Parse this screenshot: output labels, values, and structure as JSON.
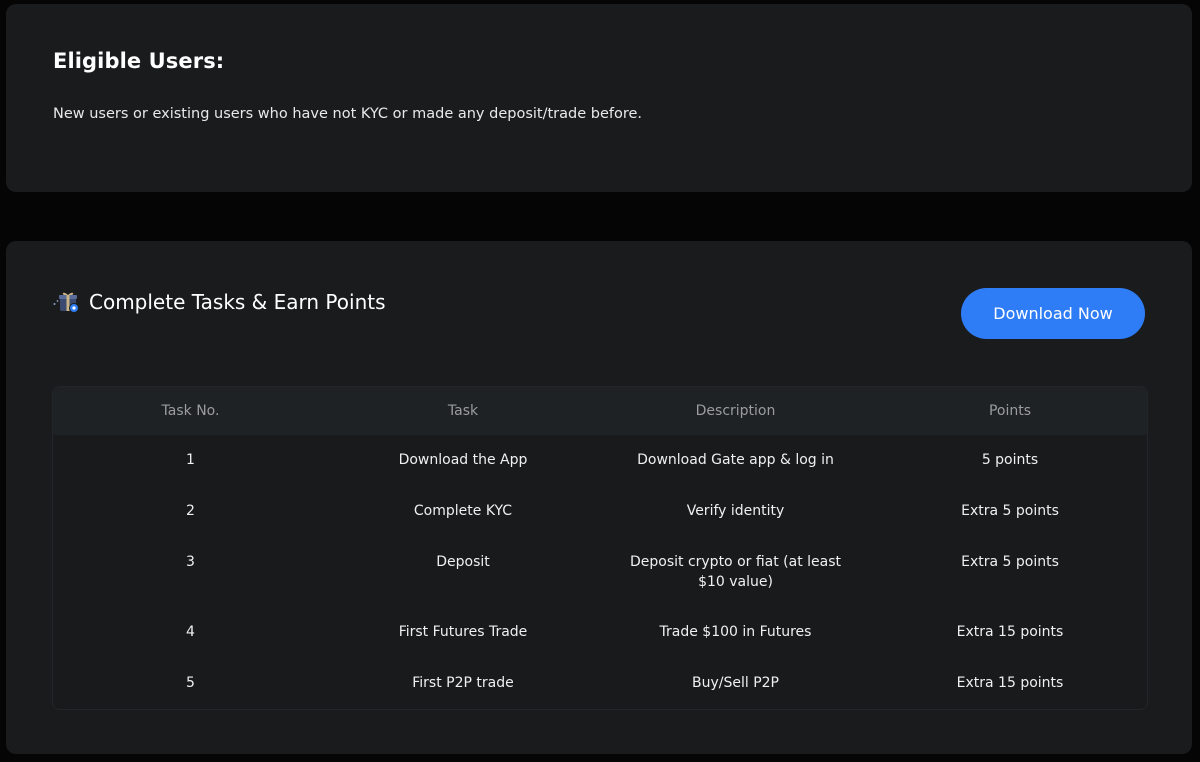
{
  "eligible": {
    "title": "Eligible Users:",
    "text": "New users or existing users who have not KYC or made any deposit/trade before."
  },
  "tasks": {
    "title": "Complete Tasks & Earn Points",
    "icon": "gift-icon",
    "download_button": "Download Now",
    "accent_color": "#2e7df6",
    "table": {
      "headers": [
        "Task No.",
        "Task",
        "Description",
        "Points"
      ],
      "rows": [
        {
          "no": "1",
          "task": "Download the App",
          "description": "Download Gate app & log in",
          "points": "5 points"
        },
        {
          "no": "2",
          "task": "Complete KYC",
          "description": "Verify identity",
          "points": "Extra 5 points"
        },
        {
          "no": "3",
          "task": "Deposit",
          "description": "Deposit crypto or fiat (at least $10 value)",
          "points": "Extra 5 points"
        },
        {
          "no": "4",
          "task": "First Futures Trade",
          "description": "Trade $100 in Futures",
          "points": "Extra 15 points"
        },
        {
          "no": "5",
          "task": "First P2P trade",
          "description": "Buy/Sell P2P",
          "points": "Extra 15 points"
        }
      ]
    }
  }
}
